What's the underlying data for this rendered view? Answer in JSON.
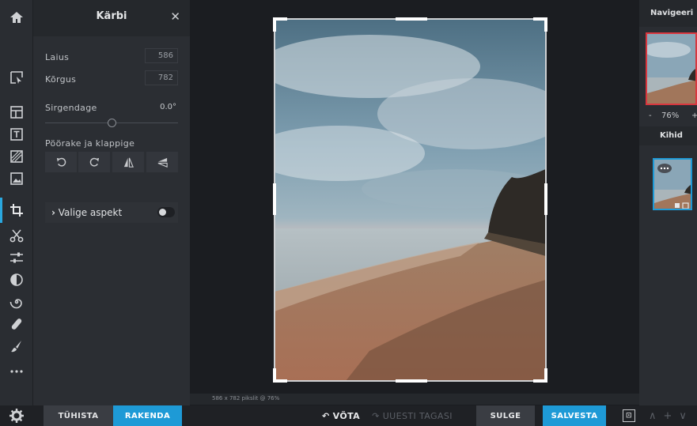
{
  "panel": {
    "title": "Kärbi",
    "close": "✕",
    "width_label": "Laius",
    "width_value": "586",
    "height_label": "Kõrgus",
    "height_value": "782",
    "straighten_label": "Sirgendage",
    "straighten_value": "0.0°",
    "straighten_level": 0.5,
    "rotate_flip_label": "Pöörake ja klappige",
    "aspect_label": "Valige aspekt",
    "aspect_toggle_on": false
  },
  "footer": {
    "cancel": "TÜHISTA",
    "apply": "RAKENDA",
    "undo": "VÕTA",
    "redo": "UUESTI TAGASI",
    "close": "SULGE",
    "save": "SALVESTA",
    "panel_toggle": "⊡",
    "layer_actions": [
      "∧",
      "+",
      "∨"
    ]
  },
  "canvas": {
    "status": "586 x 782 pikslit @ 76%"
  },
  "navigator": {
    "title": "Navigeeri",
    "zoom_minus": "-",
    "zoom_value": "76%",
    "zoom_plus": "+"
  },
  "layers": {
    "title": "Kihid"
  },
  "tools": [
    "home-icon",
    "arrange-icon",
    "template-icon",
    "text-icon",
    "texture-icon",
    "image-icon",
    "crop-icon",
    "cutout-icon",
    "adjust-icon",
    "filter-icon",
    "liquify-icon",
    "heal-icon",
    "brush-icon",
    "more-icon",
    "settings-icon"
  ],
  "colors": {
    "accent": "#1e9ad6",
    "nav_frame": "#d9363e"
  }
}
